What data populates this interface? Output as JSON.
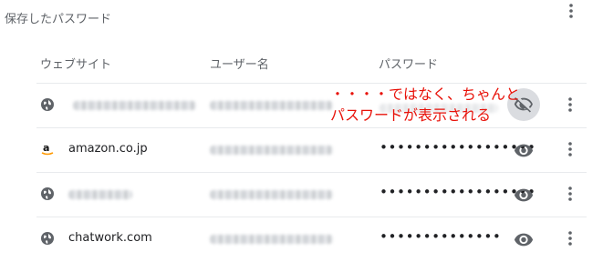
{
  "page_title": "保存したパスワード",
  "columns": {
    "website": "ウェブサイト",
    "username": "ユーザー名",
    "password": "パスワード"
  },
  "rows": [
    {
      "site": "",
      "site_icon": "globe-icon",
      "password_masked": "",
      "revealed": true
    },
    {
      "site": "amazon.co.jp",
      "site_icon": "amazon-logo-icon",
      "password_masked": "••••••••••••••••••",
      "revealed": false
    },
    {
      "site": "",
      "site_icon": "globe-icon",
      "password_masked": "••••••••••••••••••",
      "revealed": false
    },
    {
      "site": "chatwork.com",
      "site_icon": "globe-icon",
      "password_masked": "••••••••••••••",
      "revealed": false
    }
  ],
  "annotation": {
    "line1": "・・・・ではなく、ちゃんと",
    "line2": "パスワードが表示される"
  },
  "colors": {
    "annotation": "#e8120a",
    "muted": "#5f6368",
    "divider": "#e8eaed",
    "eye_active_bg": "#dadce0"
  }
}
